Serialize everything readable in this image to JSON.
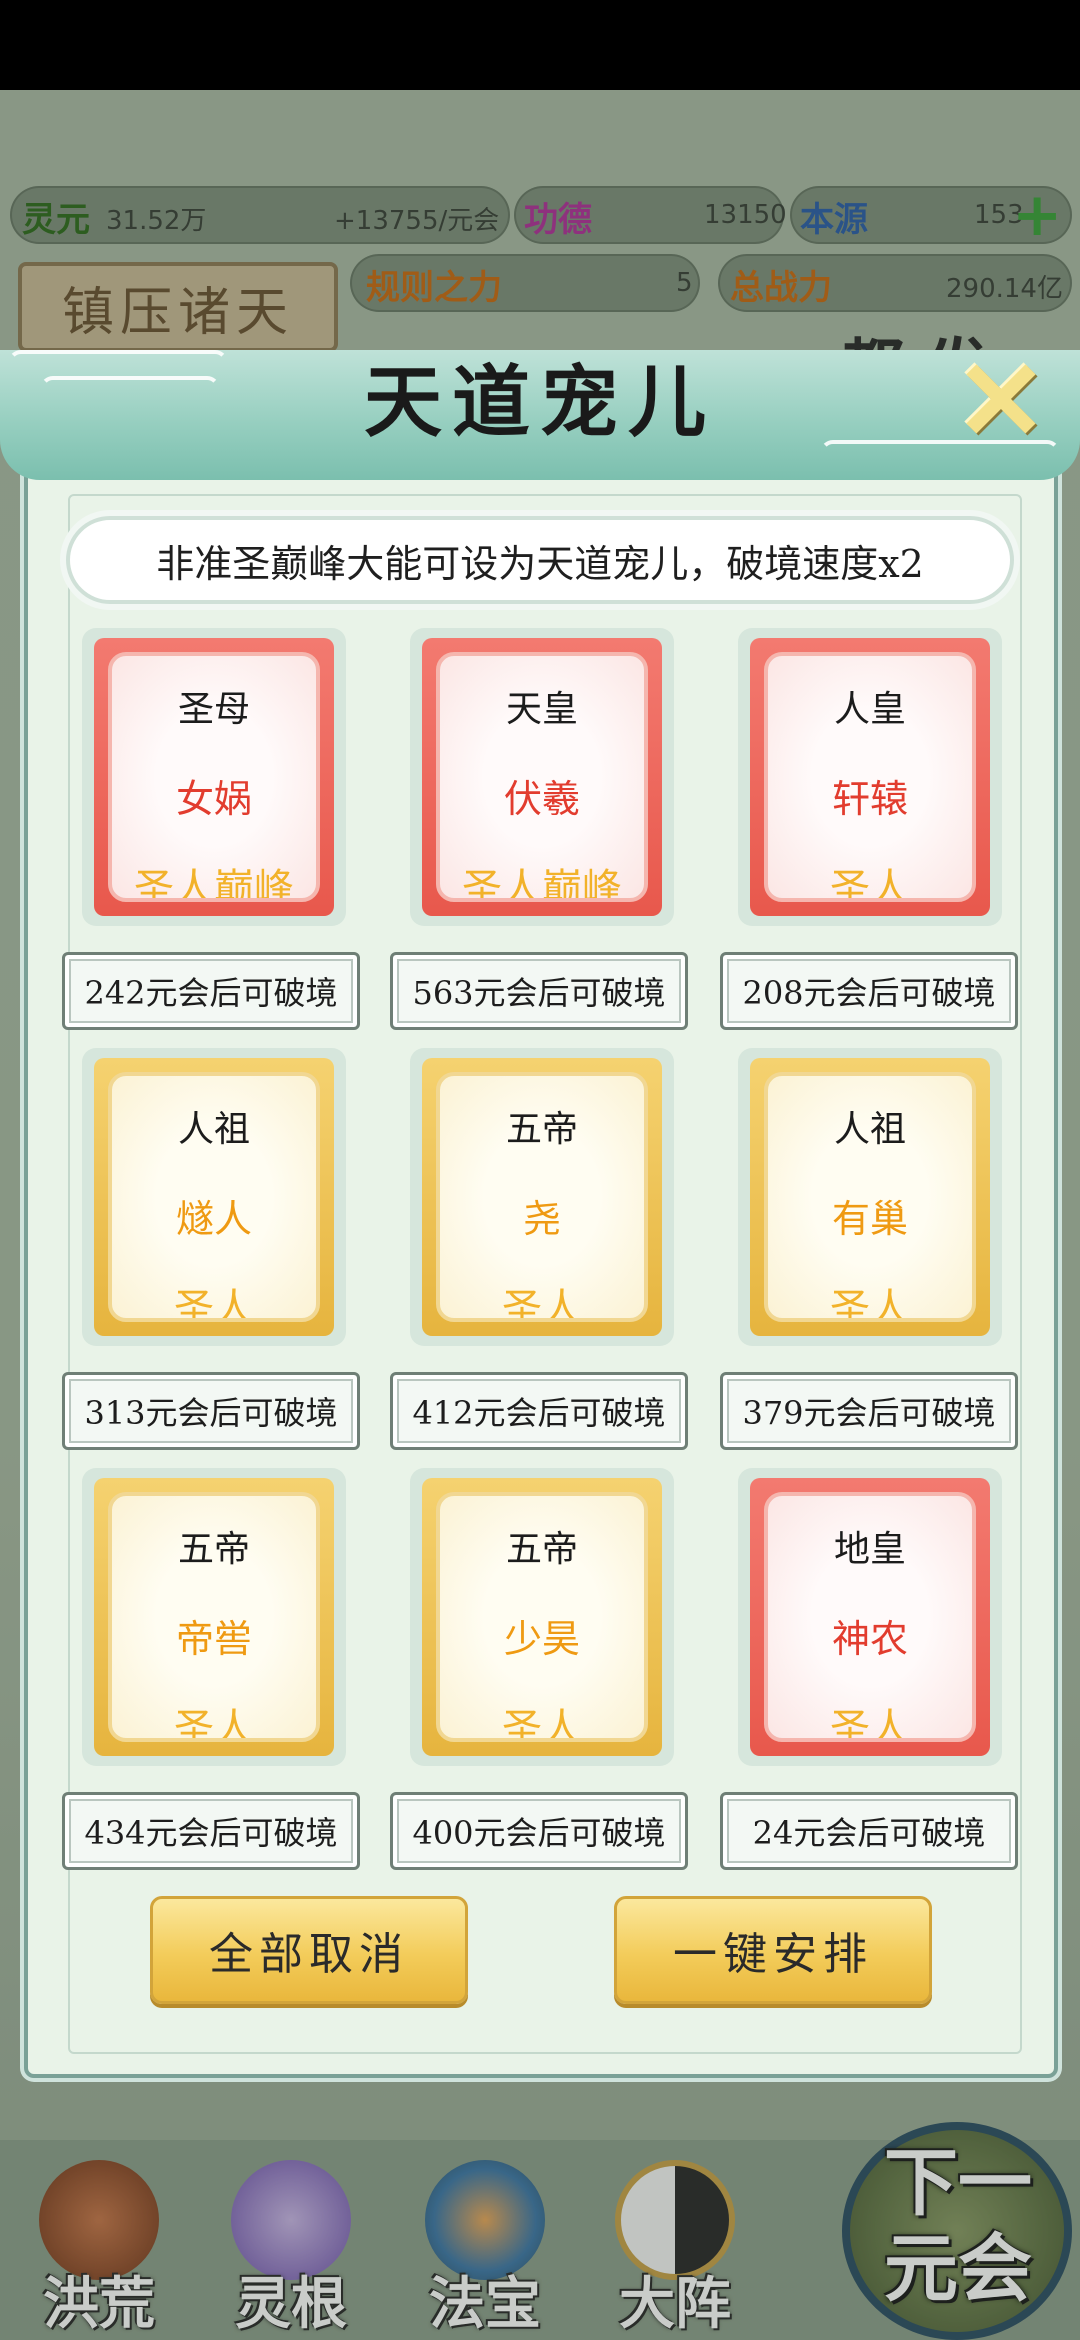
{
  "resources": {
    "lingyuan_label": "灵元",
    "lingyuan_value": "31.52万",
    "lingyuan_rate": "+13755/元会",
    "gongde_label": "功德",
    "gongde_value": "13150",
    "benyuan_label": "本源",
    "benyuan_value": "153",
    "guize_label": "规则之力",
    "guize_value": "5",
    "zhanli_label": "总战力",
    "zhanli_value": "290.14亿"
  },
  "background": {
    "plaque_text": "镇压诸天",
    "calligraphy": "都 发"
  },
  "modal": {
    "title": "天道宠儿",
    "close_symbol": "✕",
    "description": "非准圣巅峰大能可设为天道宠儿，破境速度x2",
    "cards": [
      {
        "rank": "圣母",
        "name": "女娲",
        "level": "圣人巅峰",
        "timer": "242元会后可破境",
        "color": "red"
      },
      {
        "rank": "天皇",
        "name": "伏羲",
        "level": "圣人巅峰",
        "timer": "563元会后可破境",
        "color": "red"
      },
      {
        "rank": "人皇",
        "name": "轩辕",
        "level": "圣人",
        "timer": "208元会后可破境",
        "color": "red"
      },
      {
        "rank": "人祖",
        "name": "燧人",
        "level": "圣人",
        "timer": "313元会后可破境",
        "color": "gold"
      },
      {
        "rank": "五帝",
        "name": "尧",
        "level": "圣人",
        "timer": "412元会后可破境",
        "color": "gold"
      },
      {
        "rank": "人祖",
        "name": "有巢",
        "level": "圣人",
        "timer": "379元会后可破境",
        "color": "gold"
      },
      {
        "rank": "五帝",
        "name": "帝喾",
        "level": "圣人",
        "timer": "434元会后可破境",
        "color": "gold"
      },
      {
        "rank": "五帝",
        "name": "少昊",
        "level": "圣人",
        "timer": "400元会后可破境",
        "color": "gold"
      },
      {
        "rank": "地皇",
        "name": "神农",
        "level": "圣人",
        "timer": "24元会后可破境",
        "color": "red"
      }
    ],
    "cancel_all_label": "全部取消",
    "arrange_label": "一键安排"
  },
  "nav": {
    "items": [
      {
        "label": "洪荒",
        "icon": "mountain-icon"
      },
      {
        "label": "灵根",
        "icon": "lotus-icon"
      },
      {
        "label": "法宝",
        "icon": "treasure-icon"
      },
      {
        "label": "大阵",
        "icon": "yinyang-icon"
      }
    ],
    "next_label_line1": "下一",
    "next_label_line2": "元会"
  },
  "colors": {
    "red_card": "#e8584c",
    "gold_card": "#e6b43e",
    "header_teal": "#97cfc0",
    "button_gold": "#f3cc5a"
  }
}
